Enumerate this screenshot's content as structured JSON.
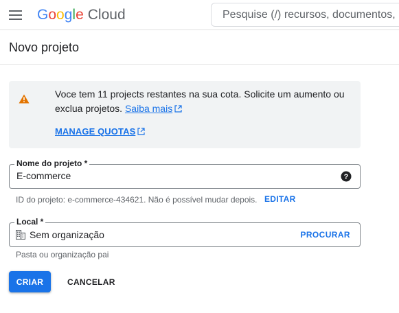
{
  "colors": {
    "primary": "#1a73e8",
    "warning": "#e37400",
    "panel_bg": "#f1f3f4",
    "text": "#202124",
    "secondary_text": "#5f6368"
  },
  "header": {
    "menu_icon": "hamburger-menu-icon",
    "logo_google": "Google",
    "logo_cloud": "Cloud",
    "search_placeholder": "Pesquise (/) recursos, documentos, produtos e muito mais"
  },
  "page": {
    "title": "Novo projeto"
  },
  "quota_notice": {
    "icon": "warning-icon",
    "message": "Voce tem 11 projects restantes na sua cota. Solicite um aumento ou exclua projetos.",
    "learn_more": "Saiba mais",
    "manage_quotas": "MANAGE QUOTAS"
  },
  "project_name": {
    "label": "Nome do projeto *",
    "value": "E-commerce",
    "help_icon": "help-icon",
    "project_id_hint": "ID do projeto: e-commerce-434621. Não é possível mudar depois.",
    "edit_label": "EDITAR"
  },
  "location": {
    "label": "Local *",
    "icon": "building-icon",
    "value": "Sem organização",
    "browse_label": "PROCURAR",
    "hint": "Pasta ou organização pai"
  },
  "actions": {
    "create_label": "CRIAR",
    "cancel_label": "CANCELAR"
  }
}
